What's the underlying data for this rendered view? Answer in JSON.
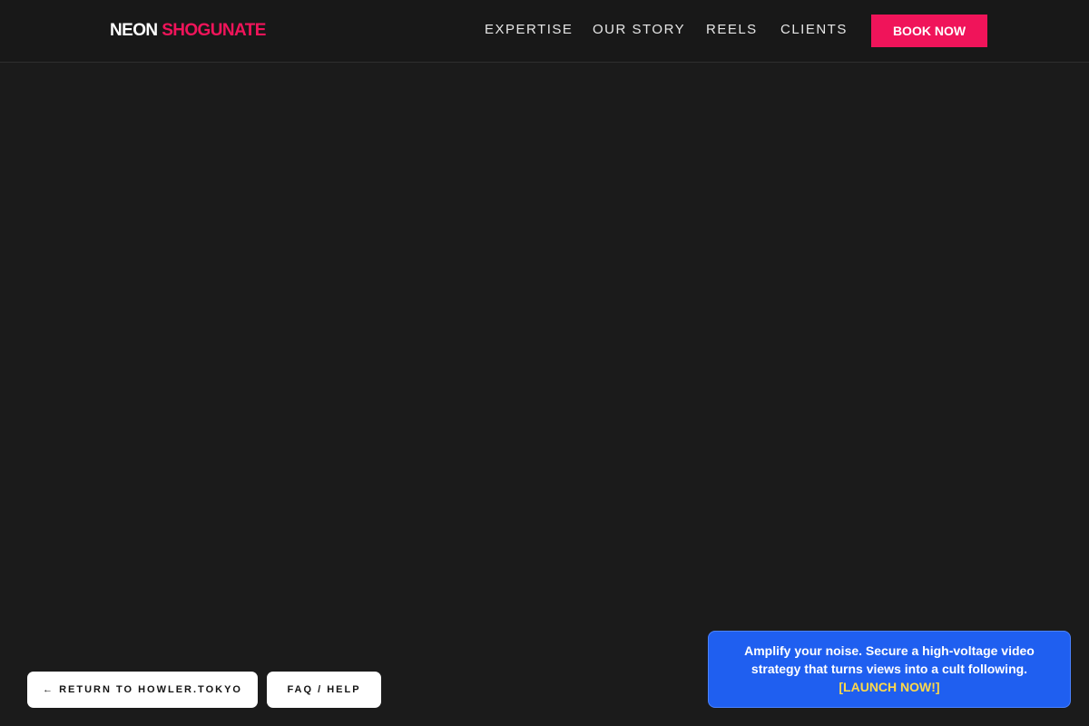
{
  "header": {
    "logo_word1": "NEON",
    "logo_word2": "SHOGUNATE",
    "nav": [
      "EXPERTISE",
      "OUR STORY",
      "REELS",
      "CLIENTS"
    ],
    "book_label": "BOOK NOW"
  },
  "footer_buttons": {
    "return_label": "← RETURN TO HOWLER.TOKYO",
    "faq_label": "FAQ / HELP"
  },
  "promo": {
    "message": "Amplify your noise. Secure a high-voltage video strategy that turns views into a cult following.",
    "cta": "[LAUNCH NOW!]"
  },
  "colors": {
    "background": "#1b1b1b",
    "accent": "#f0145a",
    "promo_bg": "#1f5ff0",
    "promo_cta": "#ffd84a"
  }
}
